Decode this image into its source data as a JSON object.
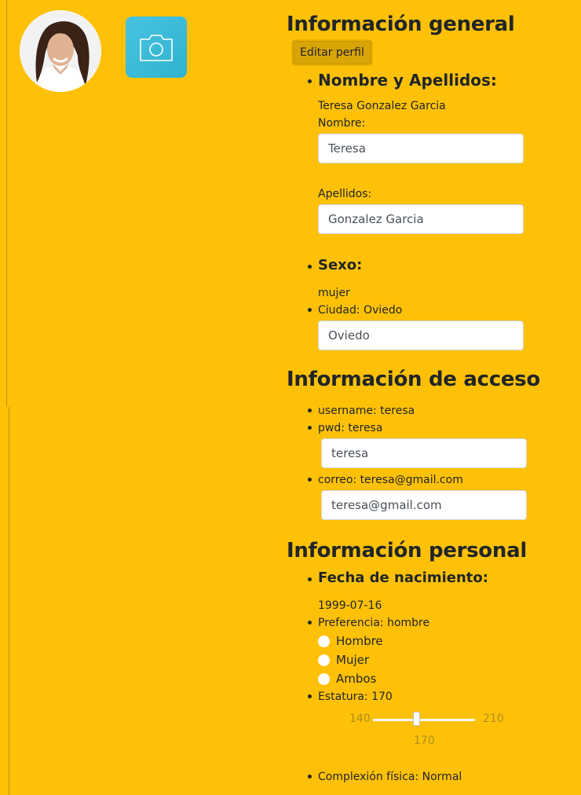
{
  "general": {
    "heading": "Información general",
    "edit_button": "Editar perfil",
    "name_section": {
      "label": "Nombre y Apellidos:",
      "full_name": "Teresa Gonzalez Garcia",
      "first_name_label": "Nombre:",
      "first_name_value": "Teresa",
      "last_name_label": "Apellidos:",
      "last_name_value": "Gonzalez Garcia"
    },
    "sex_section": {
      "label": "Sexo:",
      "value": "mujer"
    },
    "city_section": {
      "label": "Ciudad: Oviedo",
      "value": "Oviedo"
    }
  },
  "access": {
    "heading": "Información de acceso",
    "username_label": "username: teresa",
    "pwd_label": "pwd: teresa",
    "pwd_value": "teresa",
    "email_label": "correo: teresa@gmail.com",
    "email_value": "teresa@gmail.com"
  },
  "personal": {
    "heading": "Información personal",
    "birth_label": "Fecha de nacimiento:",
    "birth_value": "1999-07-16",
    "preference_label": "Preferencia: hombre",
    "preference_options": [
      "Hombre",
      "Mujer",
      "Ambos"
    ],
    "height_label": "Estatura: 170",
    "height_slider": {
      "min": "140",
      "max": "210",
      "value": "170",
      "fraction": 0.43
    },
    "complexion_label": "Complexión física: Normal"
  },
  "icons": {
    "camera": "camera-icon",
    "avatar": "avatar-photo"
  },
  "colors": {
    "background": "#fec107",
    "camera_button": "#3ebad8",
    "edit_button": "#d9a405"
  }
}
